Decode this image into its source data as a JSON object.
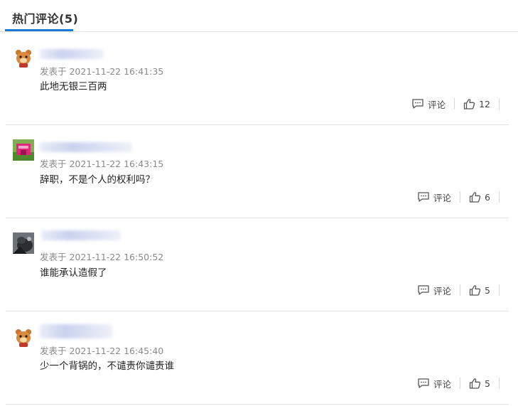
{
  "header": {
    "title": "热门评论(5)",
    "accent_color": "#1c7ad6"
  },
  "comments": [
    {
      "timestamp": "发表于 2021-11-22 16:41:35",
      "content": "此地无银三百两",
      "comment_label": "评论",
      "likes": "12",
      "avatar": "bear-avatar"
    },
    {
      "timestamp": "发表于 2021-11-22 16:43:15",
      "content": "辞职，不是个人的权利吗？",
      "comment_label": "评论",
      "likes": "6",
      "avatar": "pink-house-avatar"
    },
    {
      "timestamp": "发表于 2021-11-22 16:50:52",
      "content": "谁能承认造假了",
      "comment_label": "评论",
      "likes": "5",
      "avatar": "dark-photo-avatar"
    },
    {
      "timestamp": "发表于 2021-11-22 16:45:40",
      "content": "少一个背锅的，不谴责你谴责谁",
      "comment_label": "评论",
      "likes": "5",
      "avatar": "bear-avatar"
    }
  ],
  "icons": {
    "comment": "comment-icon",
    "like": "thumbs-up-icon"
  }
}
